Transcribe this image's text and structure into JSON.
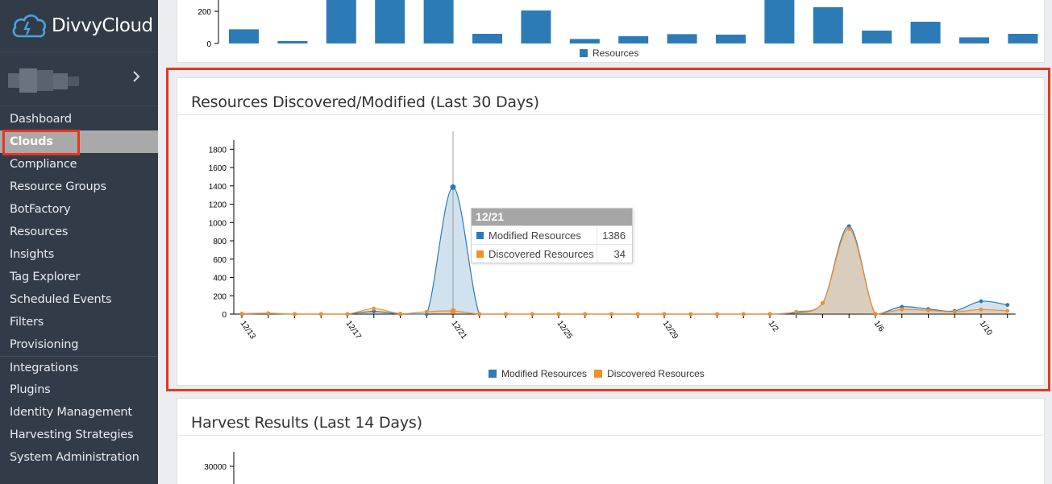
{
  "brand": {
    "name": "DivvyCloud",
    "logo_color": "#4aa3df"
  },
  "account": {
    "name": "",
    "chevron": "chevron-right-icon"
  },
  "sidebar": {
    "items": [
      {
        "label": "Dashboard"
      },
      {
        "label": "Clouds",
        "active": true
      },
      {
        "label": "Compliance"
      },
      {
        "label": "Resource Groups"
      },
      {
        "label": "BotFactory"
      },
      {
        "label": "Resources"
      },
      {
        "label": "Insights"
      },
      {
        "label": "Tag Explorer"
      },
      {
        "label": "Scheduled Events"
      },
      {
        "label": "Filters"
      },
      {
        "label": "Provisioning"
      },
      {
        "label": "Integrations"
      },
      {
        "label": "Plugins"
      },
      {
        "label": "Identity Management"
      },
      {
        "label": "Harvesting Strategies"
      },
      {
        "label": "System Administration"
      }
    ]
  },
  "colors": {
    "modified": "#2c7bb6",
    "discovered": "#f28e2b",
    "highlight": "#e8351f"
  },
  "top_panel": {
    "legend_label": "Resources",
    "chart_data": {
      "type": "bar",
      "ytick_labels": [
        "0",
        "200"
      ],
      "values": [
        88,
        15,
        330,
        330,
        330,
        60,
        205,
        28,
        45,
        58,
        55,
        330,
        225,
        80,
        135,
        38,
        60
      ],
      "series": [
        {
          "name": "Resources",
          "values": [
            88,
            15,
            330,
            330,
            330,
            60,
            205,
            28,
            45,
            58,
            55,
            330,
            225,
            80,
            135,
            38,
            60
          ]
        }
      ]
    }
  },
  "main_panel": {
    "title": "Resources Discovered/Modified (Last 30 Days)",
    "tooltip": {
      "date": "12/21",
      "rows": [
        {
          "label": "Modified Resources",
          "value": "1386"
        },
        {
          "label": "Discovered Resources",
          "value": "34"
        }
      ]
    },
    "legend": {
      "modified": "Modified Resources",
      "discovered": "Discovered Resources"
    },
    "chart_data": {
      "type": "area",
      "ylim": [
        0,
        1900
      ],
      "yticks": [
        0,
        200,
        400,
        600,
        800,
        1000,
        1200,
        1400,
        1600,
        1800
      ],
      "xtick_labels": [
        "12/13",
        "12/17",
        "12/21",
        "12/25",
        "12/29",
        "1/2",
        "1/6",
        "1/10"
      ],
      "x": [
        "12/13",
        "12/14",
        "12/15",
        "12/16",
        "12/17",
        "12/18",
        "12/19",
        "12/20",
        "12/21",
        "12/22",
        "12/23",
        "12/24",
        "12/25",
        "12/26",
        "12/27",
        "12/28",
        "12/29",
        "12/30",
        "12/31",
        "1/1",
        "1/2",
        "1/3",
        "1/4",
        "1/5",
        "1/6",
        "1/7",
        "1/8",
        "1/9",
        "1/10",
        "1/11"
      ],
      "series": [
        {
          "name": "Modified Resources",
          "values": [
            0,
            5,
            0,
            0,
            0,
            30,
            0,
            0,
            1386,
            0,
            0,
            0,
            0,
            0,
            0,
            0,
            0,
            0,
            0,
            0,
            0,
            15,
            120,
            960,
            0,
            80,
            55,
            35,
            140,
            100
          ]
        },
        {
          "name": "Discovered Resources",
          "values": [
            5,
            10,
            0,
            0,
            0,
            60,
            5,
            25,
            34,
            0,
            0,
            0,
            0,
            0,
            0,
            0,
            0,
            0,
            0,
            0,
            0,
            25,
            120,
            930,
            0,
            50,
            40,
            25,
            50,
            35
          ]
        }
      ]
    }
  },
  "bottom_panel": {
    "title": "Harvest Results (Last 14 Days)",
    "chart_data": {
      "type": "bar",
      "ytick_labels": [
        "30000"
      ]
    }
  }
}
